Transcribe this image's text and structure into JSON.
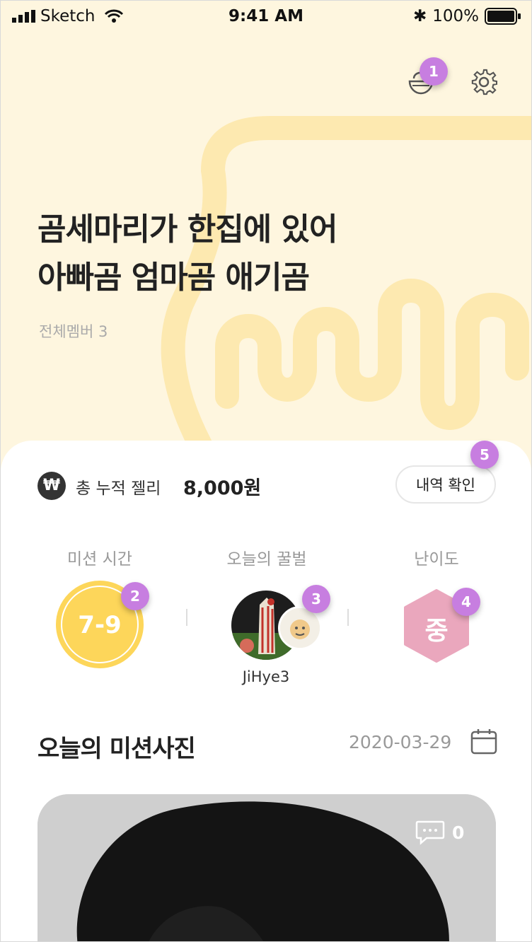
{
  "status_bar": {
    "carrier": "Sketch",
    "time": "9:41 AM",
    "battery": "100%"
  },
  "header": {
    "icons": [
      "bowl-icon",
      "gear-icon"
    ]
  },
  "badges": [
    "1",
    "2",
    "3",
    "4",
    "5"
  ],
  "hero": {
    "title_line1": "곰세마리가 한집에 있어",
    "title_line2": "아빠곰 엄마곰 애기곰",
    "members": "전체멤버 3"
  },
  "jelly": {
    "icon": "₩",
    "label": "총 누적 젤리",
    "amount": "8,000원",
    "history_button": "내역 확인"
  },
  "stats": {
    "mission_time_label": "미션 시간",
    "mission_time_value": "7-9",
    "honey_label": "오늘의 꿀벌",
    "honey_name": "JiHye3",
    "difficulty_label": "난이도",
    "difficulty_value": "중"
  },
  "today_photo": {
    "title": "오늘의 미션사진",
    "date": "2020-03-29",
    "comment_count": "0"
  },
  "colors": {
    "background": "#fef6df",
    "accent_yellow": "#fdd65a",
    "badge_purple": "#c77ee0",
    "difficulty_pink": "#eaa7bd"
  }
}
